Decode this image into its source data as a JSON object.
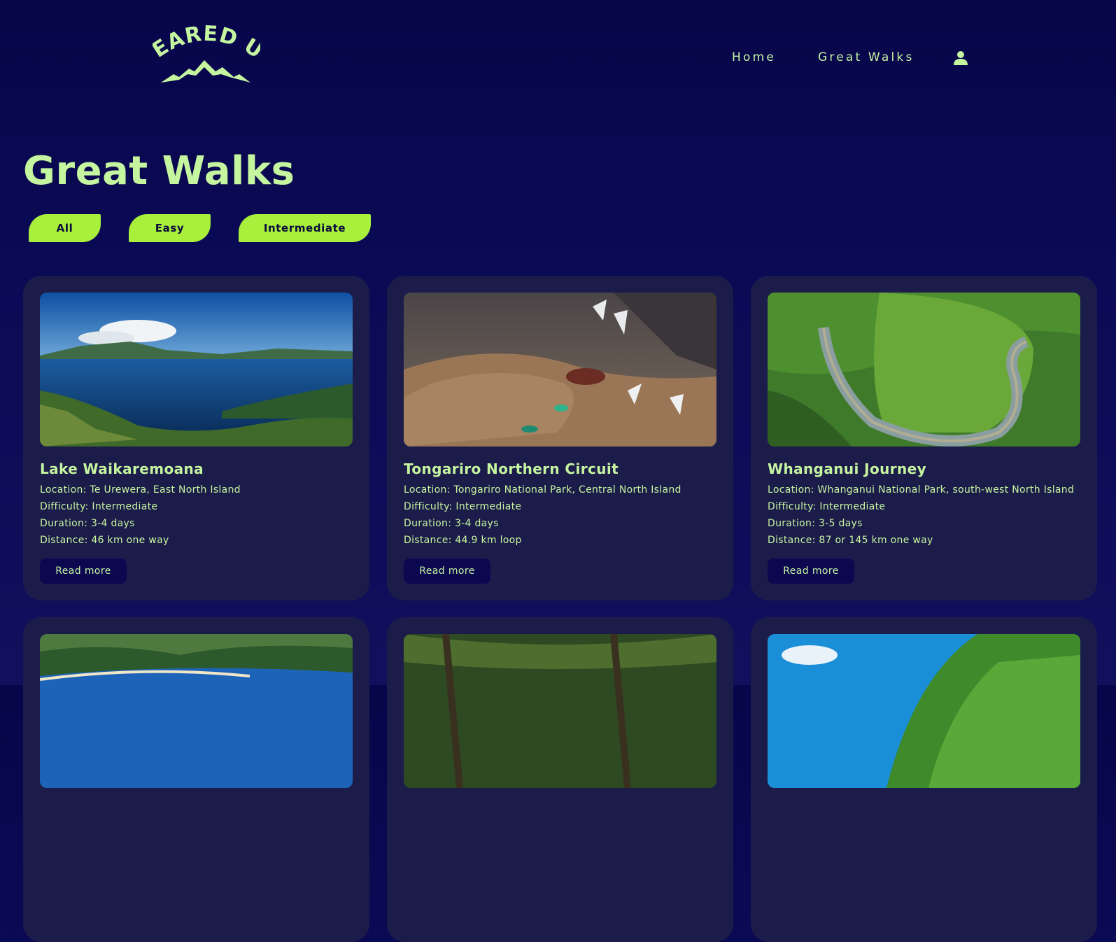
{
  "brand": {
    "logo_text": "GEARED UP",
    "accent_color": "#c6f5a0",
    "button_color": "#a8f03c"
  },
  "nav": {
    "home_label": "Home",
    "walks_label": "Great Walks",
    "user_icon": "user-icon"
  },
  "page": {
    "title": "Great Walks"
  },
  "filters": {
    "all_label": "All",
    "easy_label": "Easy",
    "intermediate_label": "Intermediate"
  },
  "cards": [
    {
      "title": "Lake Waikaremoana",
      "location": "Location: Te Urewera, East North Island",
      "difficulty": "Difficulty: Intermediate",
      "duration": "Duration: 3-4 days",
      "distance": "Distance: 46 km one way",
      "button": "Read more"
    },
    {
      "title": "Tongariro Northern Circuit",
      "location": "Location: Tongariro National Park, Central North Island",
      "difficulty": "Difficulty: Intermediate",
      "duration": "Duration: 3-4 days",
      "distance": "Distance: 44.9 km loop",
      "button": "Read more"
    },
    {
      "title": "Whanganui Journey",
      "location": "Location: Whanganui National Park, south-west North Island",
      "difficulty": "Difficulty: Intermediate",
      "duration": "Duration: 3-5 days",
      "distance": "Distance: 87 or 145 km one way",
      "button": "Read more"
    }
  ]
}
